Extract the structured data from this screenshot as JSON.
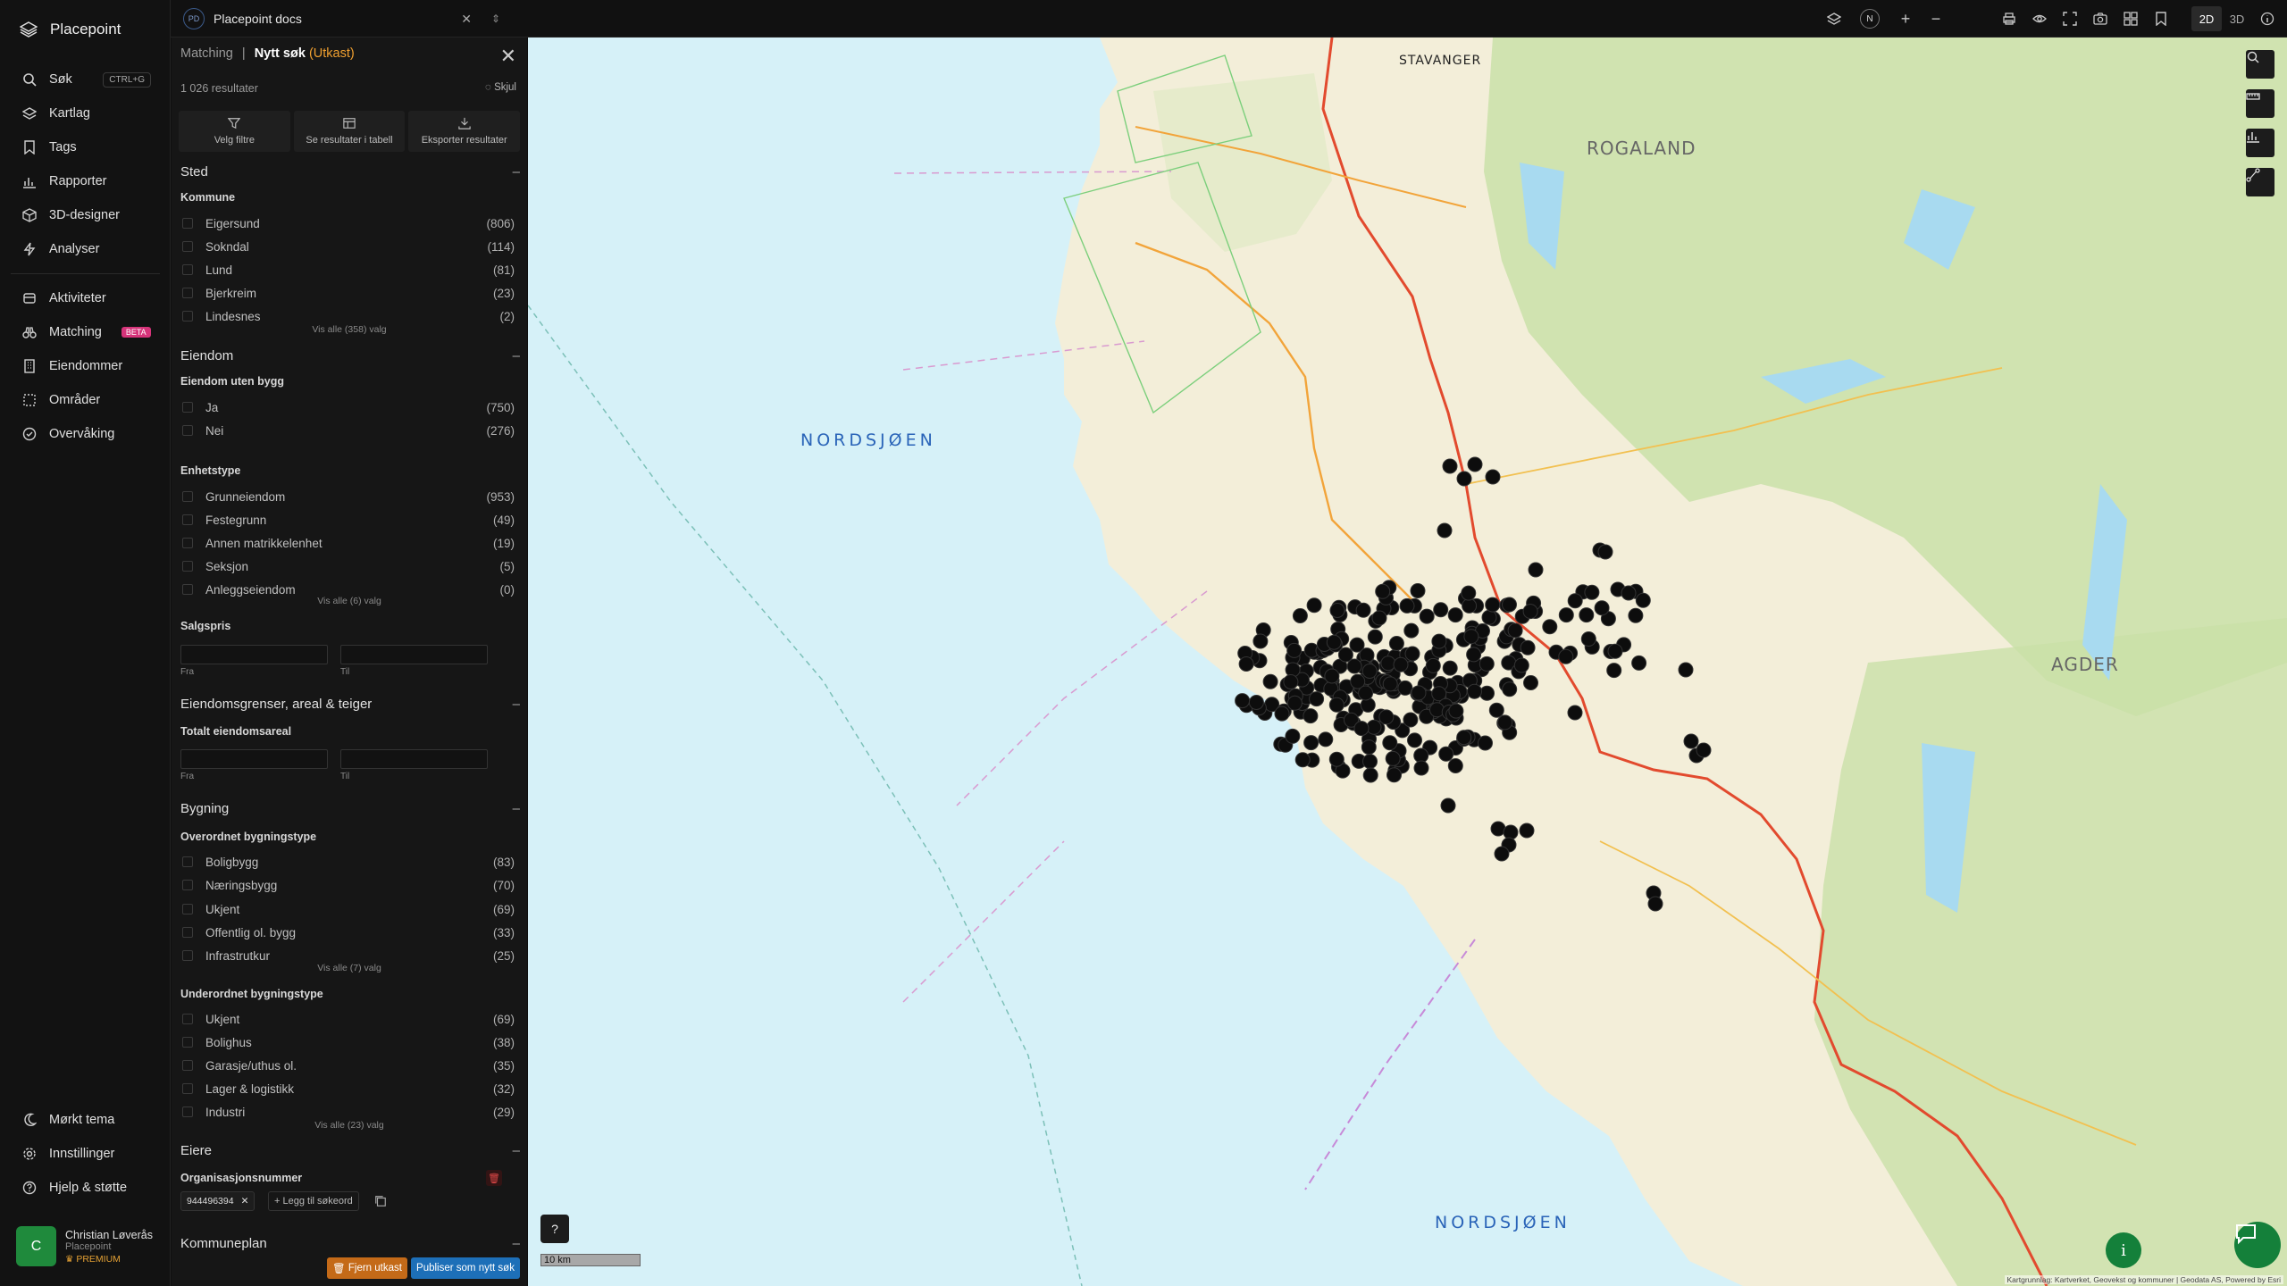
{
  "app": {
    "name": "Placepoint"
  },
  "nav": {
    "items": [
      {
        "label": "Søk",
        "icon": "search-icon",
        "shortcut": "CTRL+G"
      },
      {
        "label": "Kartlag",
        "icon": "layers-icon"
      },
      {
        "label": "Tags",
        "icon": "bookmark-icon"
      },
      {
        "label": "Rapporter",
        "icon": "chart-icon"
      },
      {
        "label": "3D-designer",
        "icon": "cube-icon"
      },
      {
        "label": "Analyser",
        "icon": "bolt-icon"
      }
    ],
    "items2": [
      {
        "label": "Aktiviteter",
        "icon": "stack-icon"
      },
      {
        "label": "Matching",
        "icon": "binoculars-icon",
        "badge": "BETA"
      },
      {
        "label": "Eiendommer",
        "icon": "building-icon"
      },
      {
        "label": "Områder",
        "icon": "area-icon"
      },
      {
        "label": "Overvåking",
        "icon": "watch-icon"
      }
    ],
    "bottom": [
      {
        "label": "Mørkt tema",
        "icon": "moon-icon"
      },
      {
        "label": "Innstillinger",
        "icon": "gear-icon"
      },
      {
        "label": "Hjelp & støtte",
        "icon": "help-icon"
      }
    ],
    "user": {
      "initial": "C",
      "name": "Christian Løverås",
      "org": "Placepoint",
      "plan": "PREMIUM"
    }
  },
  "topbar": {
    "doc_badge": "PD",
    "doc_name": "Placepoint docs",
    "compass": "N",
    "mode_2d": "2D",
    "mode_3d": "3D"
  },
  "panel": {
    "crumb": "Matching",
    "sep": "|",
    "title": "Nytt søk",
    "draft": "(Utkast)",
    "count": "1 026 resultater",
    "hide": "Skjul",
    "actions": [
      {
        "label": "Velg filtre",
        "icon": "filter-icon"
      },
      {
        "label": "Se resultater i tabell",
        "icon": "table-icon"
      },
      {
        "label": "Eksporter resultater",
        "icon": "download-icon"
      }
    ],
    "sted": {
      "title": "Sted",
      "kommune_label": "Kommune",
      "kommune": [
        {
          "name": "Eigersund",
          "count": "(806)"
        },
        {
          "name": "Sokndal",
          "count": "(114)"
        },
        {
          "name": "Lund",
          "count": "(81)"
        },
        {
          "name": "Bjerkreim",
          "count": "(23)"
        },
        {
          "name": "Lindesnes",
          "count": "(2)"
        }
      ],
      "more": "Vis alle (358) valg"
    },
    "eiendom": {
      "title": "Eiendom",
      "uten_bygg_label": "Eiendom uten bygg",
      "uten_bygg": [
        {
          "name": "Ja",
          "count": "(750)"
        },
        {
          "name": "Nei",
          "count": "(276)"
        }
      ],
      "enhetstype_label": "Enhetstype",
      "enhetstype": [
        {
          "name": "Grunneiendom",
          "count": "(953)"
        },
        {
          "name": "Festegrunn",
          "count": "(49)"
        },
        {
          "name": "Annen matrikkelenhet",
          "count": "(19)"
        },
        {
          "name": "Seksjon",
          "count": "(5)"
        },
        {
          "name": "Anleggseiendom",
          "count": "(0)"
        }
      ],
      "enhetstype_more": "Vis alle (6) valg",
      "salgspris_label": "Salgspris",
      "from": "Fra",
      "to": "Til"
    },
    "grenser": {
      "title": "Eiendomsgrenser, areal & teiger",
      "areal_label": "Totalt eiendomsareal",
      "from": "Fra",
      "to": "Til"
    },
    "bygning": {
      "title": "Bygning",
      "overordnet_label": "Overordnet bygningstype",
      "overordnet": [
        {
          "name": "Boligbygg",
          "count": "(83)"
        },
        {
          "name": "Næringsbygg",
          "count": "(70)"
        },
        {
          "name": "Ukjent",
          "count": "(69)"
        },
        {
          "name": "Offentlig ol. bygg",
          "count": "(33)"
        },
        {
          "name": "Infrastrutkur",
          "count": "(25)"
        }
      ],
      "overordnet_more": "Vis alle (7) valg",
      "underordnet_label": "Underordnet bygningstype",
      "underordnet": [
        {
          "name": "Ukjent",
          "count": "(69)"
        },
        {
          "name": "Bolighus",
          "count": "(38)"
        },
        {
          "name": "Garasje/uthus ol.",
          "count": "(35)"
        },
        {
          "name": "Lager & logistikk",
          "count": "(32)"
        },
        {
          "name": "Industri",
          "count": "(29)"
        }
      ],
      "underordnet_more": "Vis alle (23) valg"
    },
    "eiere": {
      "title": "Eiere",
      "org_label": "Organisasjonsnummer",
      "tag": "944496394",
      "add": "+ Legg til søkeord"
    },
    "kommuneplan": {
      "title": "Kommuneplan"
    },
    "remove_draft": "Fjern utkast",
    "publish": "Publiser som nytt søk"
  },
  "map": {
    "labels": {
      "sea1": "NORDSJØEN",
      "sea2": "NORDSJØEN",
      "rogaland": "ROGALAND",
      "agder": "AGDER",
      "stavanger": "STAVANGER"
    },
    "scale": "10 km",
    "attribution": "Kartgrunnlag: Kartverket, Geovekst og kommuner | Geodata AS, Powered by Esri",
    "colors": {
      "sea": "#d6f1f8",
      "land": "#f3eed9",
      "forest": "#c9e0a8",
      "marker": "#0d0d0d",
      "road": "#e24a2e"
    }
  }
}
